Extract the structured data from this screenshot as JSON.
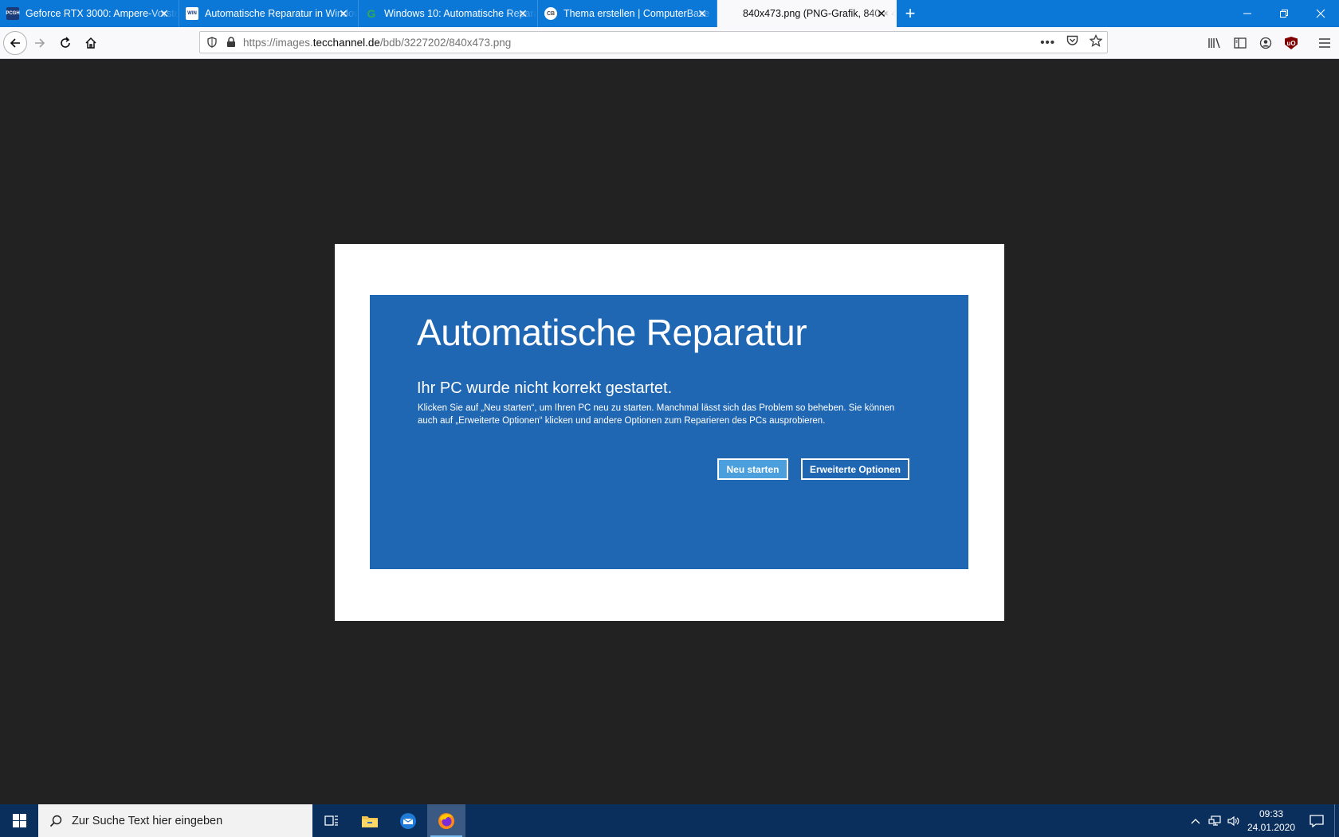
{
  "browser": {
    "tabs": [
      {
        "favicon": "pcgh-favicon",
        "favicon_text": "PCGH",
        "title": "Geforce RTX 3000: Ampere-Vorstellung",
        "active": false
      },
      {
        "favicon": "win-favicon",
        "favicon_text": "WIN",
        "title": "Automatische Reparatur in Windows",
        "active": false
      },
      {
        "favicon": "google-favicon",
        "favicon_text": "G",
        "title": "Windows 10: Automatische Reparatur",
        "active": false
      },
      {
        "favicon": "computerbase-favicon",
        "favicon_text": "CB",
        "title": "Thema erstellen | ComputerBase",
        "active": false
      },
      {
        "favicon": "none",
        "favicon_text": "",
        "title": "840x473.png (PNG-Grafik, 840 × 473 Pixel)",
        "active": true
      }
    ],
    "url": {
      "prefix": "https://images.",
      "domain": "tecchannel.de",
      "path": "/bdb/3227202/840x473.png"
    }
  },
  "repair": {
    "title": "Automatische Reparatur",
    "subtitle": "Ihr PC wurde nicht korrekt gestartet.",
    "text": "Klicken Sie auf „Neu starten“, um Ihren PC neu zu starten. Manchmal lässt sich das Problem so beheben. Sie können auch auf „Erweiterte Optionen“ klicken und andere Optionen zum Reparieren des PCs ausprobieren.",
    "restart_label": "Neu starten",
    "advanced_label": "Erweiterte Optionen"
  },
  "taskbar": {
    "search_placeholder": "Zur Suche Text hier eingeben",
    "time": "09:33",
    "date": "24.01.2020"
  },
  "colors": {
    "tabstrip": "#0b78d7",
    "viewer_background": "#222222",
    "repair_blue": "#2067b3",
    "taskbar": "#0b2f5c"
  }
}
